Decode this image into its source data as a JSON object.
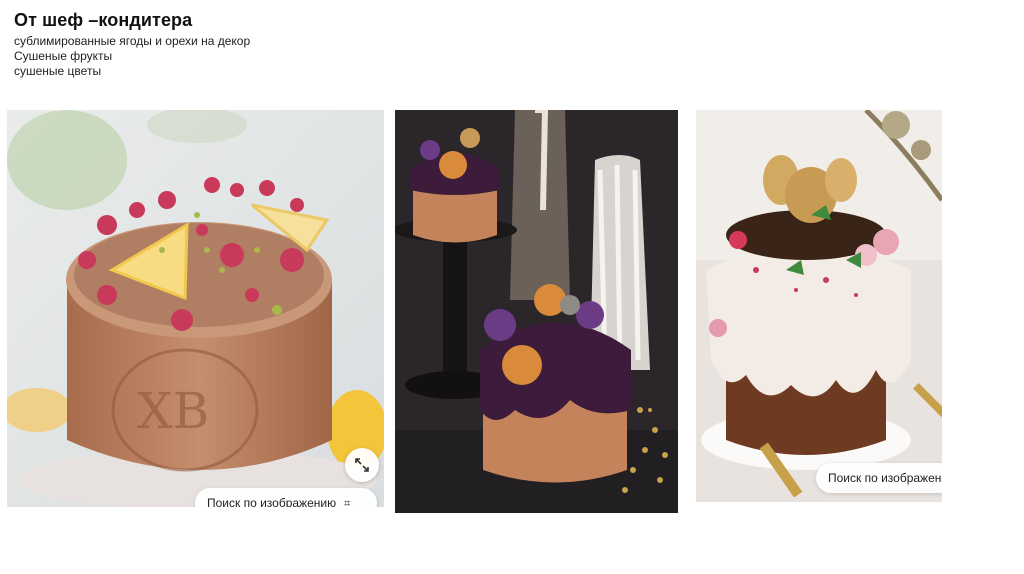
{
  "slide": {
    "title": "От шеф –кондитера",
    "bullets": [
      "сублимированные ягоды и орехи на декор",
      "Сушеные фрукты",
      "сушеные цветы"
    ]
  },
  "photos": {
    "photo1": {
      "search_label": "Поиск по изображению",
      "expand_icon": "expand-arrows-icon"
    },
    "photo3": {
      "search_label": "Поиск по изображению"
    }
  },
  "colors": {
    "background": "#ffffff",
    "chocolate": "#b9815f",
    "dark_glaze": "#3d1b3a",
    "white_glaze": "#f3ece6"
  }
}
